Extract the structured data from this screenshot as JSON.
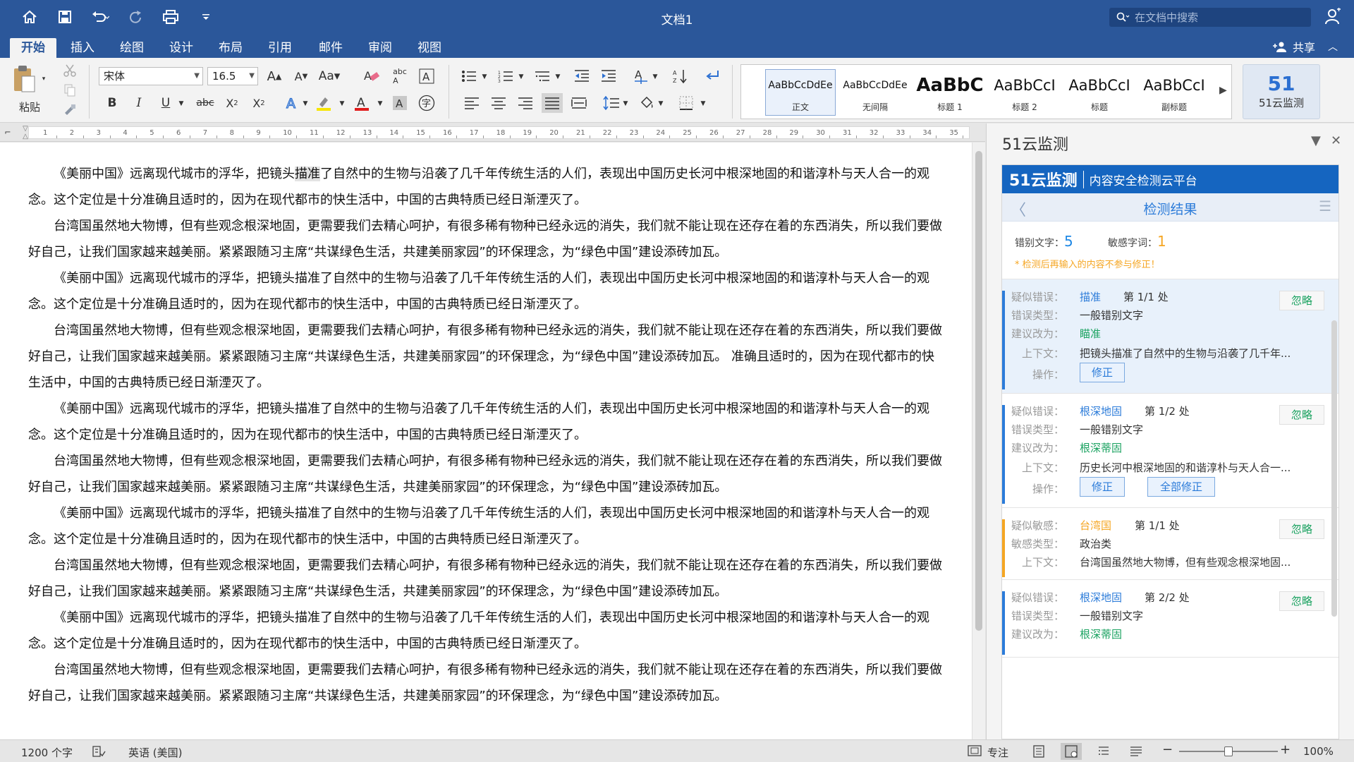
{
  "title": "文档1",
  "search": {
    "placeholder": "在文档中搜索"
  },
  "tabs": [
    "开始",
    "插入",
    "绘图",
    "设计",
    "布局",
    "引用",
    "邮件",
    "审阅",
    "视图"
  ],
  "share_label": "共享",
  "ribbon": {
    "paste_label": "粘贴",
    "font_name": "宋体",
    "font_size": "16.5",
    "styles": [
      {
        "preview": "AaBbCcDdEe",
        "name": "正文"
      },
      {
        "preview": "AaBbCcDdEe",
        "name": "无间隔"
      },
      {
        "preview": "AaBbC",
        "name": "标题 1"
      },
      {
        "preview": "AaBbCcI",
        "name": "标题 2"
      },
      {
        "preview": "AaBbCcI",
        "name": "标题"
      },
      {
        "preview": "AaBbCcI",
        "name": "副标题"
      }
    ],
    "plugin_label": "51云监测",
    "plugin_logo": "51"
  },
  "ruler_ticks": [
    "1",
    "2",
    "3",
    "4",
    "5",
    "6",
    "7",
    "8",
    "9",
    "10",
    "11",
    "12",
    "13",
    "14",
    "15",
    "16",
    "17",
    "18",
    "19",
    "20",
    "21",
    "22",
    "23",
    "24",
    "25",
    "26",
    "27",
    "28",
    "29",
    "30",
    "31",
    "32",
    "33",
    "34",
    "35"
  ],
  "document": {
    "paragraphs": [
      "《美丽中国》远离现代城市的浮华，把镜头描准了自然中的生物与沿袭了几千年传统生活的人们，表现出中国历史长河中根深地固的和谐淳朴与天人合一的观念。这个定位是十分准确且适时的，因为在现代都市的快生活中，中国的古典特质已经日渐湮灭了。",
      "台湾国虽然地大物博，但有些观念根深地固，更需要我们去精心呵护，有很多稀有物种已经永远的消失，我们就不能让现在还存在着的东西消失，所以我们要做好自己，让我们国家越来越美丽。紧紧跟随习主席“共谋绿色生活，共建美丽家园”的环保理念，为“绿色中国”建设添砖加瓦。",
      "《美丽中国》远离现代城市的浮华，把镜头描准了自然中的生物与沿袭了几千年传统生活的人们，表现出中国历史长河中根深地固的和谐淳朴与天人合一的观念。这个定位是十分准确且适时的，因为在现代都市的快生活中，中国的古典特质已经日渐湮灭了。",
      "台湾国虽然地大物博，但有些观念根深地固，更需要我们去精心呵护，有很多稀有物种已经永远的消失，我们就不能让现在还存在着的东西消失，所以我们要做好自己，让我们国家越来越美丽。紧紧跟随习主席“共谋绿色生活，共建美丽家园”的环保理念，为“绿色中国”建设添砖加瓦。 准确且适时的，因为在现代都市的快生活中，中国的古典特质已经日渐湮灭了。",
      "《美丽中国》远离现代城市的浮华，把镜头描准了自然中的生物与沿袭了几千年传统生活的人们，表现出中国历史长河中根深地固的和谐淳朴与天人合一的观念。这个定位是十分准确且适时的，因为在现代都市的快生活中，中国的古典特质已经日渐湮灭了。",
      "台湾国虽然地大物博，但有些观念根深地固，更需要我们去精心呵护，有很多稀有物种已经永远的消失，我们就不能让现在还存在着的东西消失，所以我们要做好自己，让我们国家越来越美丽。紧紧跟随习主席“共谋绿色生活，共建美丽家园”的环保理念，为“绿色中国”建设添砖加瓦。",
      "《美丽中国》远离现代城市的浮华，把镜头描准了自然中的生物与沿袭了几千年传统生活的人们，表现出中国历史长河中根深地固的和谐淳朴与天人合一的观念。这个定位是十分准确且适时的，因为在现代都市的快生活中，中国的古典特质已经日渐湮灭了。",
      "台湾国虽然地大物博，但有些观念根深地固，更需要我们去精心呵护，有很多稀有物种已经永远的消失，我们就不能让现在还存在着的东西消失，所以我们要做好自己，让我们国家越来越美丽。紧紧跟随习主席“共谋绿色生活，共建美丽家园”的环保理念，为“绿色中国”建设添砖加瓦。",
      "《美丽中国》远离现代城市的浮华，把镜头描准了自然中的生物与沿袭了几千年传统生活的人们，表现出中国历史长河中根深地固的和谐淳朴与天人合一的观念。这个定位是十分准确且适时的，因为在现代都市的快生活中，中国的古典特质已经日渐湮灭了。",
      "台湾国虽然地大物博，但有些观念根深地固，更需要我们去精心呵护，有很多稀有物种已经永远的消失，我们就不能让现在还存在着的东西消失，所以我们要做好自己，让我们国家越来越美丽。紧紧跟随习主席“共谋绿色生活，共建美丽家园”的环保理念，为“绿色中国”建设添砖加瓦。"
    ]
  },
  "pane": {
    "title": "51云监测",
    "brand_logo": "51云监测",
    "brand_slogan": "内容安全检测云平台",
    "results_title": "检测结果",
    "typo_label": "错别文字：",
    "typo_count": "5",
    "sensitive_label": "敏感字词：",
    "sensitive_count": "1",
    "note": "* 检测后再输入的内容不参与修正！",
    "ignore_label": "忽略",
    "fix_label": "修正",
    "fix_all_label": "全部修正",
    "cards": [
      {
        "l1": "疑似错误：",
        "word": "描准",
        "pos": "第 1/1 处",
        "l2": "错误类型：",
        "type": "一般错别文字",
        "l3": "建议改为：",
        "suggest": "瞄准",
        "l4": "上下文：",
        "context": "把镜头描准了自然中的生物与沿袭了几千年...",
        "l5": "操作："
      },
      {
        "l1": "疑似错误：",
        "word": "根深地固",
        "pos": "第 1/2 处",
        "l2": "错误类型：",
        "type": "一般错别文字",
        "l3": "建议改为：",
        "suggest": "根深蒂固",
        "l4": "上下文：",
        "context": "历史长河中根深地固的和谐淳朴与天人合一...",
        "l5": "操作："
      },
      {
        "l1": "疑似敏感：",
        "word": "台湾国",
        "pos": "第 1/1 处",
        "l2": "敏感类型：",
        "type": "政治类",
        "l4": "上下文：",
        "context": "台湾国虽然地大物博，但有些观念根深地固..."
      },
      {
        "l1": "疑似错误：",
        "word": "根深地固",
        "pos": "第 2/2 处",
        "l2": "错误类型：",
        "type": "一般错别文字",
        "l3": "建议改为：",
        "suggest": "根深蒂固"
      }
    ]
  },
  "status": {
    "word_count": "1200 个字",
    "language": "英语 (美国)",
    "focus": "专注",
    "zoom": "100%",
    "zoom_level": 0.5
  },
  "colors": {
    "brand": "#2b579a",
    "plugin": "#1565c0",
    "accent": "#2b7bd9",
    "warn": "#f5a623",
    "ok": "#1aa260"
  }
}
